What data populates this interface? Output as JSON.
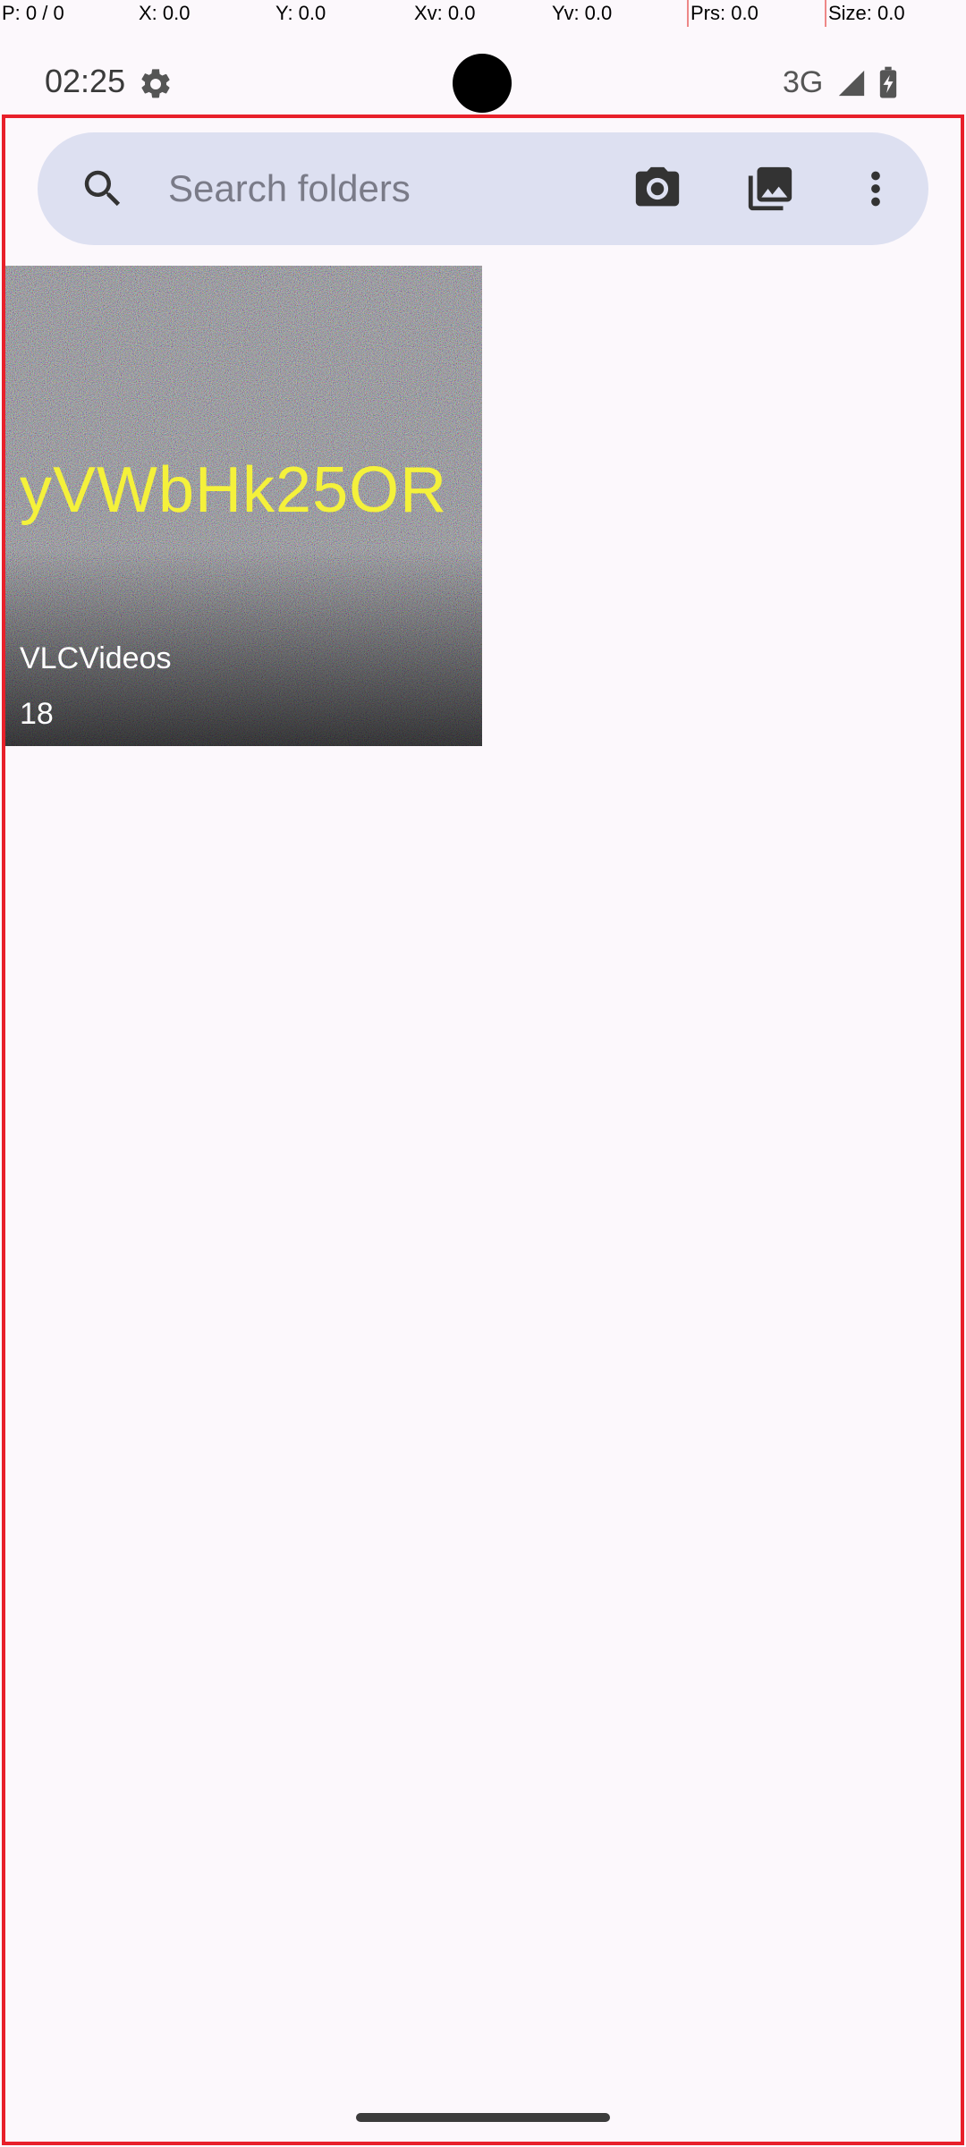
{
  "debug": {
    "pointer": "P: 0 / 0",
    "x": "X: 0.0",
    "y": "Y: 0.0",
    "xv": "Xv: 0.0",
    "yv": "Yv: 0.0",
    "prs": "Prs: 0.0",
    "size": "Size: 0.0"
  },
  "status": {
    "time": "02:25",
    "network": "3G",
    "icons": [
      "settings-gear-icon",
      "cell-signal-icon",
      "battery-charging-icon"
    ]
  },
  "search": {
    "placeholder": "Search folders",
    "value": "",
    "icons": [
      "search-icon",
      "camera-icon",
      "gallery-icon",
      "more-vert-icon"
    ]
  },
  "folders": [
    {
      "name": "VLCVideos",
      "count": "18",
      "thumbnail_text": "yVWbHk25OR"
    }
  ],
  "colors": {
    "background": "#fcf8fc",
    "search_bg": "#dde0f1",
    "frame_border": "#e8202a",
    "thumb_text": "#f4f13b"
  }
}
